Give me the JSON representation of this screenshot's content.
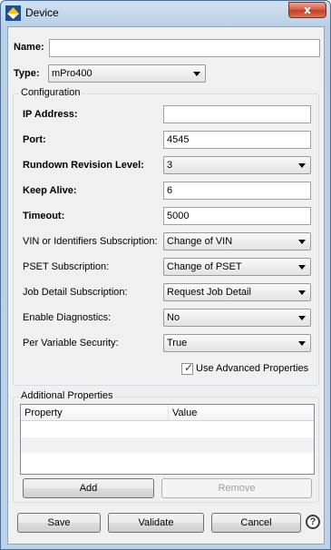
{
  "window": {
    "title": "Device",
    "close_glyph": "x"
  },
  "form": {
    "name_label": "Name:",
    "name_value": "",
    "type_label": "Type:",
    "type_value": "mPro400"
  },
  "configuration": {
    "title": "Configuration",
    "ip_label": "IP Address:",
    "ip_value": "",
    "port_label": "Port:",
    "port_value": "4545",
    "rundown_label": "Rundown Revision Level:",
    "rundown_value": "3",
    "keepalive_label": "Keep Alive:",
    "keepalive_value": "6",
    "timeout_label": "Timeout:",
    "timeout_value": "5000",
    "vin_label": "VIN or Identifiers Subscription:",
    "vin_value": "Change of VIN",
    "pset_label": "PSET Subscription:",
    "pset_value": "Change of PSET",
    "job_label": "Job Detail Subscription:",
    "job_value": "Request Job Detail",
    "diag_label": "Enable Diagnostics:",
    "diag_value": "No",
    "security_label": "Per Variable Security:",
    "security_value": "True",
    "advanced_label": "Use Advanced Properties",
    "advanced_checked": true
  },
  "additional": {
    "title": "Additional Properties",
    "columns": [
      "Property",
      "Value"
    ],
    "add_label": "Add",
    "remove_label": "Remove"
  },
  "footer": {
    "save_label": "Save",
    "validate_label": "Validate",
    "cancel_label": "Cancel",
    "help_glyph": "?"
  },
  "colors": {
    "titlebar": "#bcd2ea",
    "close": "#c53d20",
    "panel": "#f0f0f0"
  }
}
